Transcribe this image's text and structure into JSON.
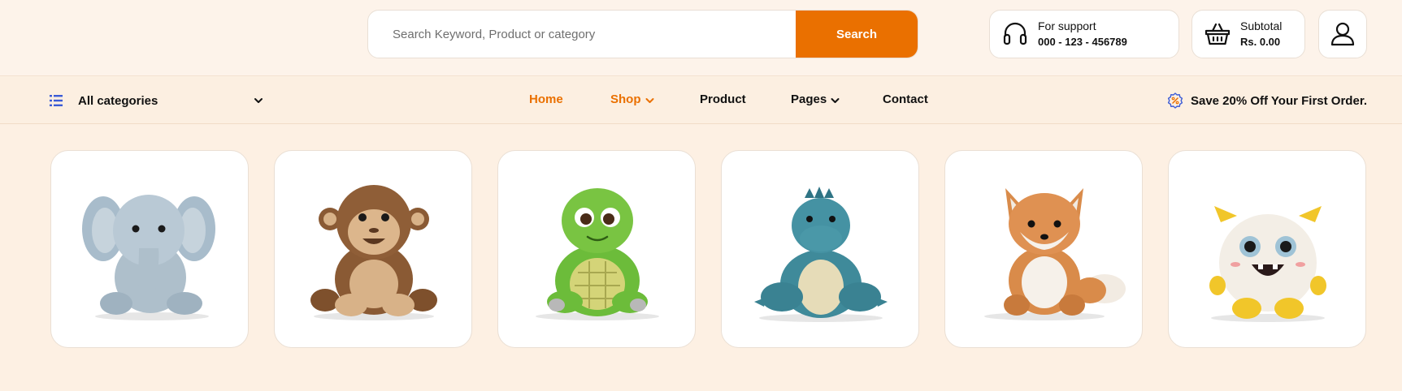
{
  "search": {
    "placeholder": "Search Keyword, Product or category",
    "button_label": "Search"
  },
  "support": {
    "icon": "headphones-icon",
    "label": "For support",
    "value": "000 - 123 - 456789"
  },
  "cart": {
    "icon": "basket-icon",
    "label": "Subtotal",
    "value": "Rs. 0.00"
  },
  "user": {
    "icon": "user-icon"
  },
  "categories": {
    "icon": "list-icon",
    "label": "All categories",
    "chevron": "chevron-down-icon"
  },
  "nav": {
    "items": [
      {
        "label": "Home",
        "active": true
      },
      {
        "label": "Shop",
        "active": true,
        "has_dropdown": true
      },
      {
        "label": "Product",
        "active": false
      },
      {
        "label": "Pages",
        "active": false,
        "has_dropdown": true
      },
      {
        "label": "Contact",
        "active": false
      }
    ]
  },
  "promo": {
    "icon": "discount-badge-icon",
    "text": "Save 20% Off Your First Order."
  },
  "products": [
    {
      "icon": "elephant-plush-image"
    },
    {
      "icon": "monkey-plush-image"
    },
    {
      "icon": "turtle-plush-image"
    },
    {
      "icon": "dinosaur-plush-image"
    },
    {
      "icon": "fox-plush-image"
    },
    {
      "icon": "monster-plush-image"
    }
  ],
  "colors": {
    "accent": "#ea7000",
    "background": "#fdf0e3",
    "nav_active": "#ea7000",
    "category_icon": "#3b5bd6"
  }
}
